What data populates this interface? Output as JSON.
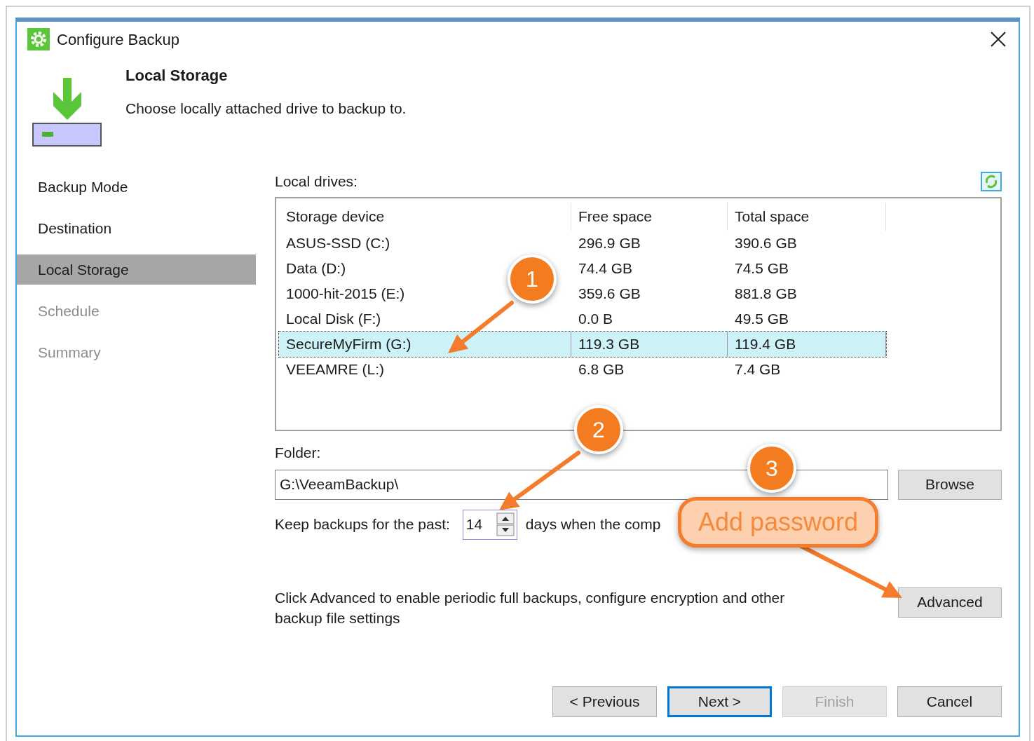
{
  "window": {
    "title": "Configure Backup"
  },
  "header": {
    "title": "Local Storage",
    "subtitle": "Choose locally attached drive to backup to."
  },
  "steps": [
    {
      "label": "Backup Mode",
      "selected": false,
      "disabled": false
    },
    {
      "label": "Destination",
      "selected": false,
      "disabled": false
    },
    {
      "label": "Local Storage",
      "selected": true,
      "disabled": false
    },
    {
      "label": "Schedule",
      "selected": false,
      "disabled": true
    },
    {
      "label": "Summary",
      "selected": false,
      "disabled": true
    }
  ],
  "drives": {
    "label": "Local drives:",
    "columns": [
      "Storage device",
      "Free space",
      "Total space"
    ],
    "rows": [
      {
        "cells": [
          "ASUS-SSD (C:)",
          "296.9 GB",
          "390.6 GB"
        ],
        "selected": false
      },
      {
        "cells": [
          "Data (D:)",
          "74.4 GB",
          "74.5 GB"
        ],
        "selected": false
      },
      {
        "cells": [
          "1000-hit-2015 (E:)",
          "359.6 GB",
          "881.8 GB"
        ],
        "selected": false
      },
      {
        "cells": [
          "Local Disk (F:)",
          "0.0 B",
          "49.5 GB"
        ],
        "selected": false
      },
      {
        "cells": [
          "SecureMyFirm (G:)",
          "119.3 GB",
          "119.4 GB"
        ],
        "selected": true
      },
      {
        "cells": [
          "VEEAMRE (L:)",
          "6.8 GB",
          "7.4 GB"
        ],
        "selected": false
      }
    ]
  },
  "folder": {
    "label": "Folder:",
    "value": "G:\\VeeamBackup\\",
    "button": "Browse"
  },
  "retention": {
    "label": "Keep backups for the past:",
    "value": "14",
    "suffix": "days when the comp"
  },
  "advanced": {
    "text": "Click Advanced to enable periodic full backups, configure encryption and other backup file settings",
    "button": "Advanced"
  },
  "buttons": [
    {
      "label": "< Previous",
      "default": false,
      "disabled": false
    },
    {
      "label": "Next >",
      "default": true,
      "disabled": false
    },
    {
      "label": "Finish",
      "default": false,
      "disabled": true
    },
    {
      "label": "Cancel",
      "default": false,
      "disabled": false
    }
  ],
  "annotations": [
    {
      "kind": "number",
      "text": "1"
    },
    {
      "kind": "number",
      "text": "2"
    },
    {
      "kind": "number",
      "text": "3"
    },
    {
      "kind": "label",
      "text": "Add password"
    }
  ]
}
